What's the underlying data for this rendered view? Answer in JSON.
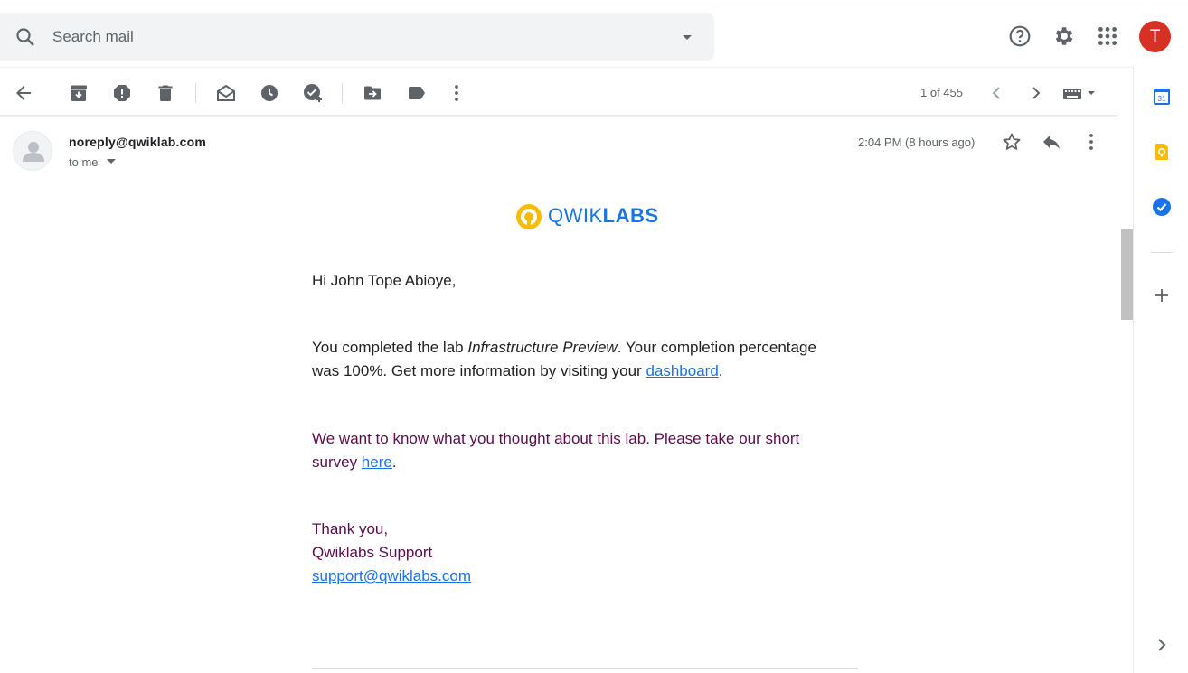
{
  "search": {
    "placeholder": "Search mail"
  },
  "header": {
    "avatar_letter": "T",
    "avatar_color": "#d93025"
  },
  "toolbar": {
    "pagination": "1 of 455"
  },
  "message": {
    "sender": "noreply@qwiklab.com",
    "recipient": "to me",
    "timestamp": "2:04 PM (8 hours ago)"
  },
  "email": {
    "logo_prefix": "QWIK",
    "logo_suffix": "LABS",
    "greeting": "Hi John Tope Abioye,",
    "p1_a": "You completed the lab ",
    "p1_italic": "Infrastructure Preview",
    "p1_b": ". Your completion percentage",
    "p1_c": "was 100%. Get more information by visiting your ",
    "p1_link": "dashboard",
    "p1_end": ".",
    "p2_a": "We want to know what you thought about this lab. Please take our short",
    "p2_b": "survey ",
    "p2_link": "here",
    "p2_end": ".",
    "closing": "Thank you,",
    "signature": "Qwiklabs Support",
    "support_email": "support@qwiklabs.com"
  },
  "icons": {
    "header": [
      "search-icon",
      "chevron-down-icon",
      "help-icon",
      "gear-icon",
      "apps-icon"
    ],
    "toolbar": [
      "back-arrow-icon",
      "archive-icon",
      "report-spam-icon",
      "delete-icon",
      "mark-unread-icon",
      "snooze-icon",
      "add-task-icon",
      "move-to-icon",
      "label-icon",
      "more-vertical-icon",
      "chevron-left-icon",
      "chevron-right-icon",
      "keyboard-icon"
    ],
    "message": [
      "star-icon",
      "reply-icon",
      "more-vertical-icon"
    ],
    "side_panel": [
      "calendar-icon",
      "keep-icon",
      "tasks-icon",
      "plus-icon",
      "chevron-right-icon"
    ]
  },
  "colors": {
    "accent": "#1a73e8",
    "purple_text": "#5b0e4d",
    "logo_yellow": "#f9bc05"
  }
}
